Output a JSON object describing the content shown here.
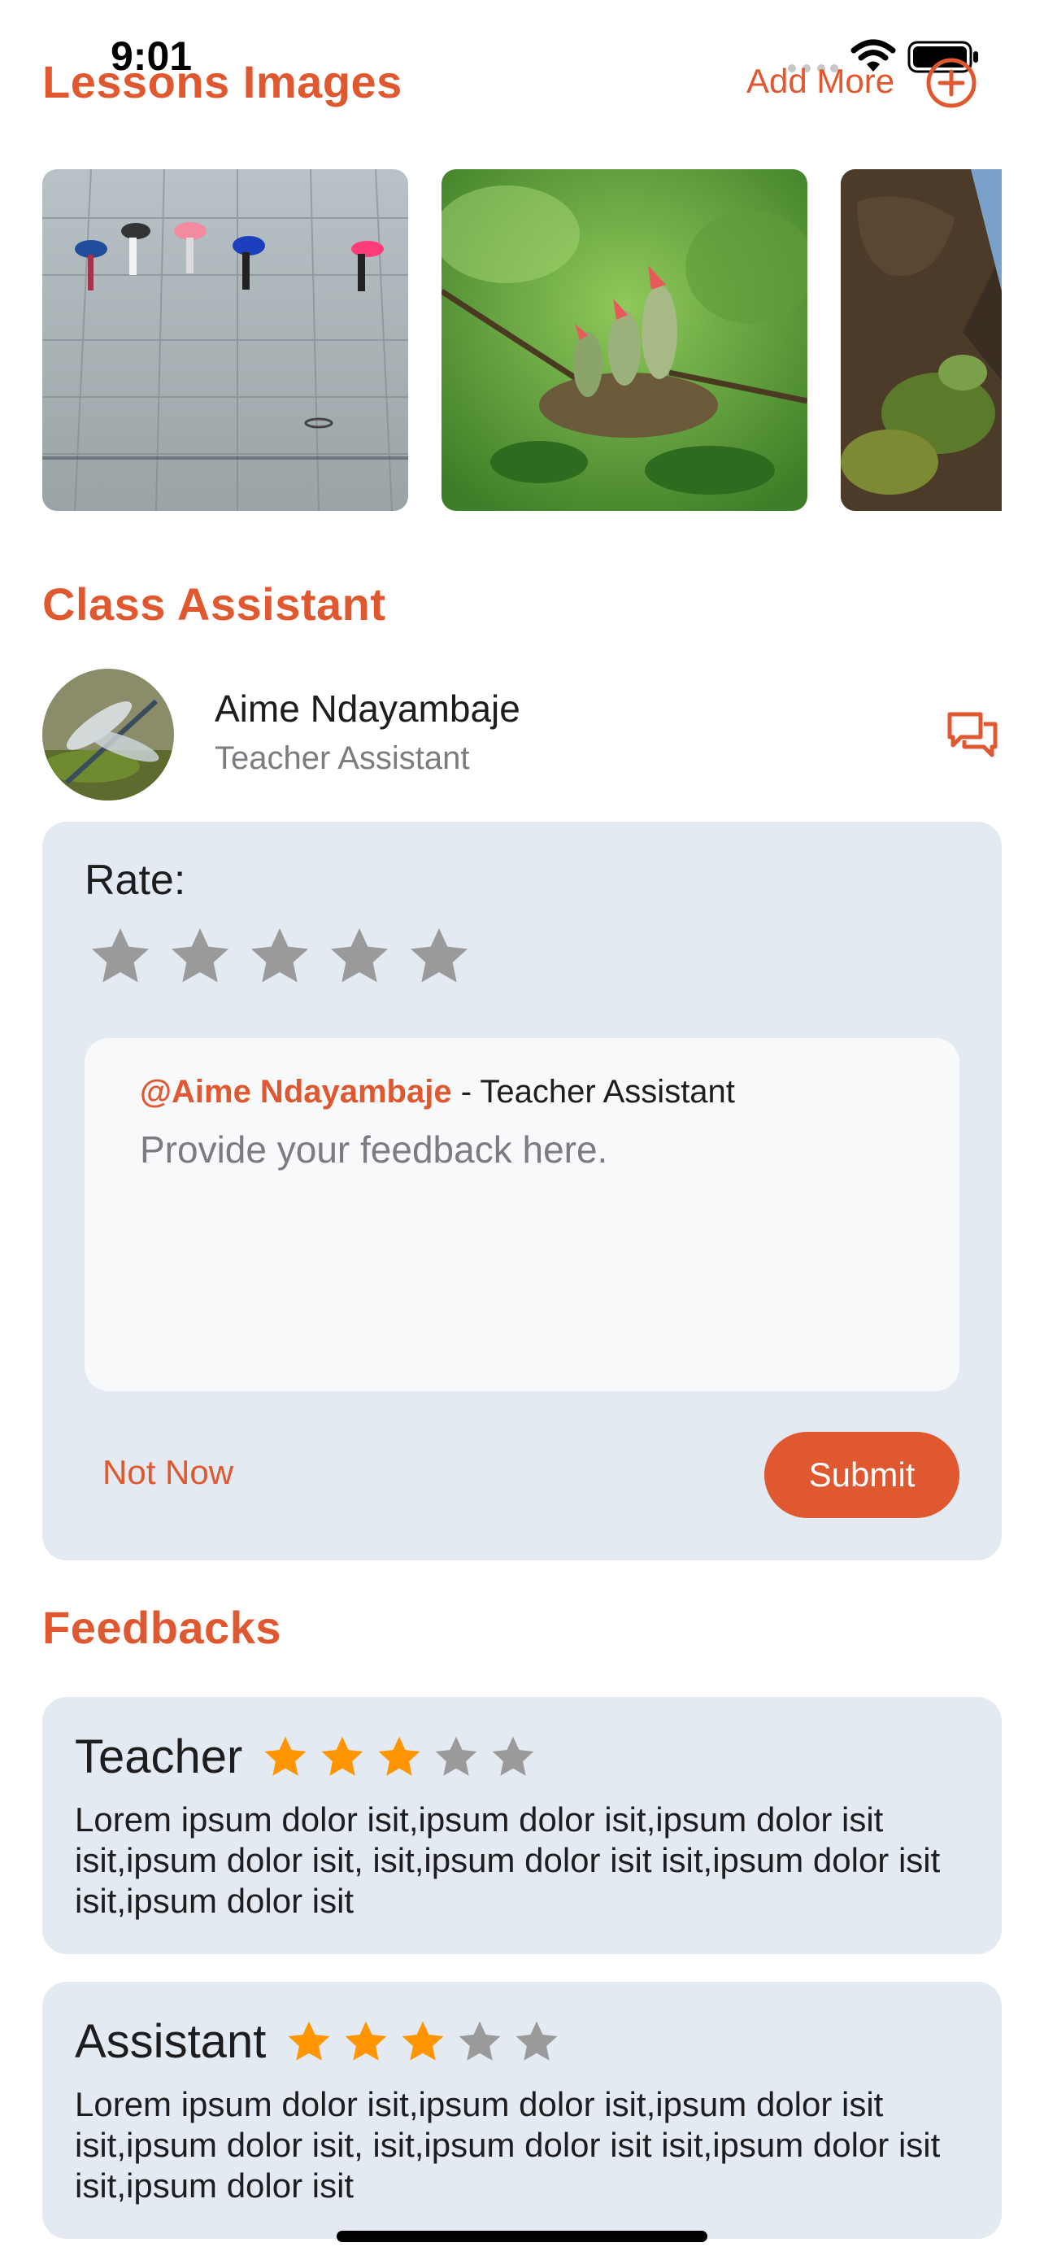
{
  "status_bar": {
    "time": "9:01"
  },
  "header": {
    "title": "Lessons Images",
    "add_more_label": "Add More"
  },
  "lesson_images": [
    {
      "name": "umbrellas-plaza"
    },
    {
      "name": "bird-nest"
    },
    {
      "name": "rocky-cliff"
    }
  ],
  "class_assistant": {
    "section_title": "Class Assistant",
    "name": "Aime Ndayambaje",
    "role": "Teacher Assistant"
  },
  "rate_card": {
    "label": "Rate:",
    "stars": 5,
    "rating": 0,
    "mention_name": "@Aime Ndayambaje",
    "mention_rest": " - Teacher Assistant",
    "placeholder": "Provide your feedback here.",
    "not_now_label": "Not Now",
    "submit_label": "Submit"
  },
  "feedbacks": {
    "section_title": "Feedbacks",
    "items": [
      {
        "title": "Teacher",
        "rating": 3,
        "max": 5,
        "text": "Lorem ipsum dolor isit,ipsum dolor isit,ipsum dolor isit isit,ipsum dolor isit, isit,ipsum dolor isit isit,ipsum dolor isit isit,ipsum dolor isit"
      },
      {
        "title": "Assistant",
        "rating": 3,
        "max": 5,
        "text": "Lorem ipsum dolor isit,ipsum dolor isit,ipsum dolor isit isit,ipsum dolor isit, isit,ipsum dolor isit isit,ipsum dolor isit isit,ipsum dolor isit"
      }
    ]
  },
  "colors": {
    "accent": "#e0582f",
    "card": "#e4eaf2",
    "star_filled": "#ff9500",
    "star_empty": "#9a9a9a"
  }
}
